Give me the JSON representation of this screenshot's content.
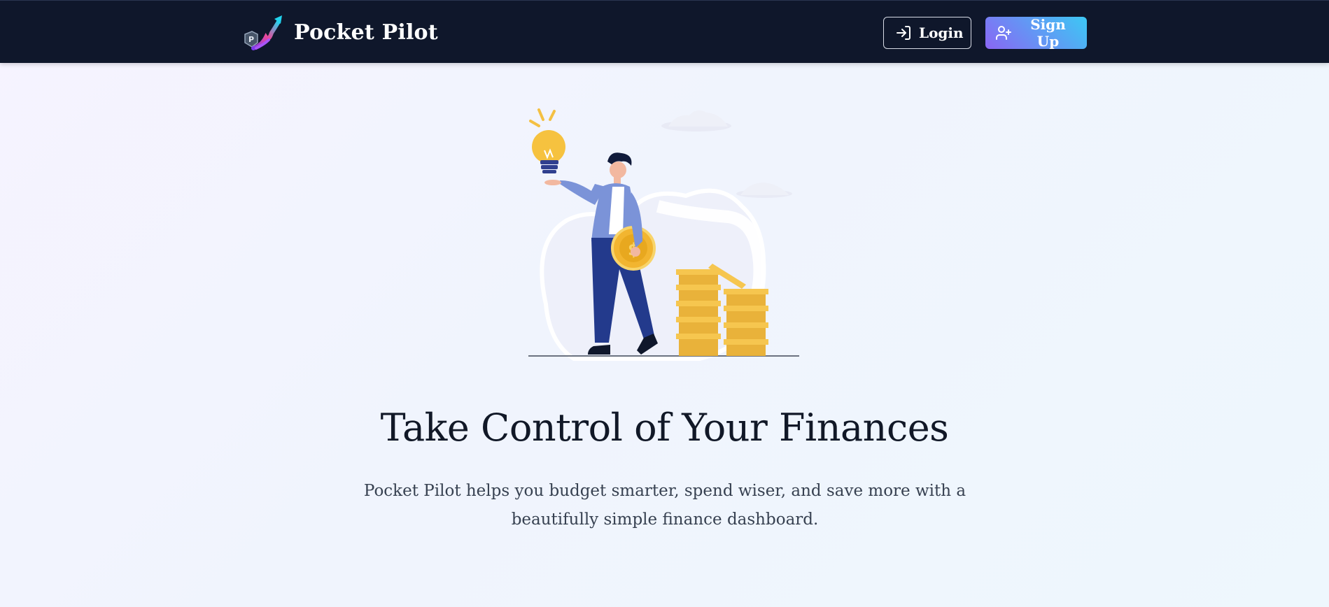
{
  "header": {
    "brand_name": "Pocket Pilot",
    "logo_icon": "chart-arrow-logo-icon",
    "login_label": "Login",
    "login_icon": "login-icon",
    "signup_label": "Sign Up",
    "signup_icon": "user-plus-icon"
  },
  "hero": {
    "illustration": "man-with-lightbulb-and-coins-illustration",
    "title": "Take Control of Your Finances",
    "subtitle": "Pocket Pilot helps you budget smarter, spend wiser, and save more with a beautifully simple finance dashboard."
  },
  "colors": {
    "navbar_bg": "#0f172b",
    "signup_gradient_start": "#8a66f4",
    "signup_gradient_end": "#3cc8f4",
    "title_text": "#111827",
    "body_text": "#374151",
    "coin_gold": "#f1b935"
  }
}
